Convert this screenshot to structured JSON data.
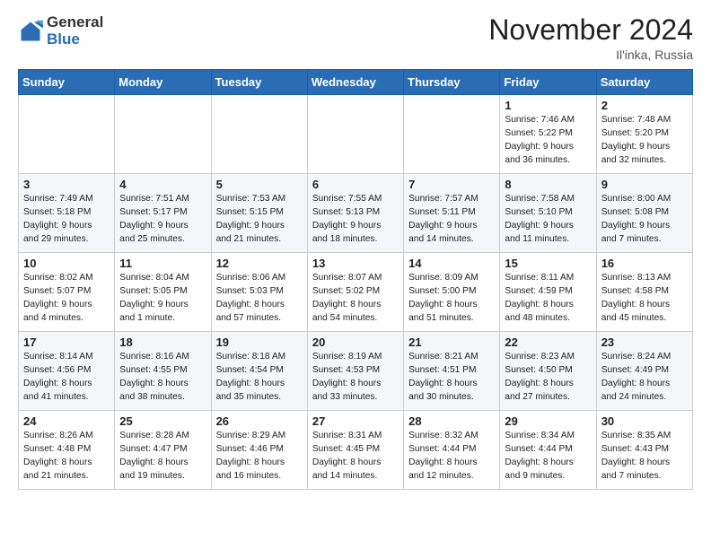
{
  "logo": {
    "general": "General",
    "blue": "Blue"
  },
  "header": {
    "month": "November 2024",
    "location": "Il'inka, Russia"
  },
  "weekdays": [
    "Sunday",
    "Monday",
    "Tuesday",
    "Wednesday",
    "Thursday",
    "Friday",
    "Saturday"
  ],
  "weeks": [
    [
      {
        "day": "",
        "info": ""
      },
      {
        "day": "",
        "info": ""
      },
      {
        "day": "",
        "info": ""
      },
      {
        "day": "",
        "info": ""
      },
      {
        "day": "",
        "info": ""
      },
      {
        "day": "1",
        "info": "Sunrise: 7:46 AM\nSunset: 5:22 PM\nDaylight: 9 hours\nand 36 minutes."
      },
      {
        "day": "2",
        "info": "Sunrise: 7:48 AM\nSunset: 5:20 PM\nDaylight: 9 hours\nand 32 minutes."
      }
    ],
    [
      {
        "day": "3",
        "info": "Sunrise: 7:49 AM\nSunset: 5:18 PM\nDaylight: 9 hours\nand 29 minutes."
      },
      {
        "day": "4",
        "info": "Sunrise: 7:51 AM\nSunset: 5:17 PM\nDaylight: 9 hours\nand 25 minutes."
      },
      {
        "day": "5",
        "info": "Sunrise: 7:53 AM\nSunset: 5:15 PM\nDaylight: 9 hours\nand 21 minutes."
      },
      {
        "day": "6",
        "info": "Sunrise: 7:55 AM\nSunset: 5:13 PM\nDaylight: 9 hours\nand 18 minutes."
      },
      {
        "day": "7",
        "info": "Sunrise: 7:57 AM\nSunset: 5:11 PM\nDaylight: 9 hours\nand 14 minutes."
      },
      {
        "day": "8",
        "info": "Sunrise: 7:58 AM\nSunset: 5:10 PM\nDaylight: 9 hours\nand 11 minutes."
      },
      {
        "day": "9",
        "info": "Sunrise: 8:00 AM\nSunset: 5:08 PM\nDaylight: 9 hours\nand 7 minutes."
      }
    ],
    [
      {
        "day": "10",
        "info": "Sunrise: 8:02 AM\nSunset: 5:07 PM\nDaylight: 9 hours\nand 4 minutes."
      },
      {
        "day": "11",
        "info": "Sunrise: 8:04 AM\nSunset: 5:05 PM\nDaylight: 9 hours\nand 1 minute."
      },
      {
        "day": "12",
        "info": "Sunrise: 8:06 AM\nSunset: 5:03 PM\nDaylight: 8 hours\nand 57 minutes."
      },
      {
        "day": "13",
        "info": "Sunrise: 8:07 AM\nSunset: 5:02 PM\nDaylight: 8 hours\nand 54 minutes."
      },
      {
        "day": "14",
        "info": "Sunrise: 8:09 AM\nSunset: 5:00 PM\nDaylight: 8 hours\nand 51 minutes."
      },
      {
        "day": "15",
        "info": "Sunrise: 8:11 AM\nSunset: 4:59 PM\nDaylight: 8 hours\nand 48 minutes."
      },
      {
        "day": "16",
        "info": "Sunrise: 8:13 AM\nSunset: 4:58 PM\nDaylight: 8 hours\nand 45 minutes."
      }
    ],
    [
      {
        "day": "17",
        "info": "Sunrise: 8:14 AM\nSunset: 4:56 PM\nDaylight: 8 hours\nand 41 minutes."
      },
      {
        "day": "18",
        "info": "Sunrise: 8:16 AM\nSunset: 4:55 PM\nDaylight: 8 hours\nand 38 minutes."
      },
      {
        "day": "19",
        "info": "Sunrise: 8:18 AM\nSunset: 4:54 PM\nDaylight: 8 hours\nand 35 minutes."
      },
      {
        "day": "20",
        "info": "Sunrise: 8:19 AM\nSunset: 4:53 PM\nDaylight: 8 hours\nand 33 minutes."
      },
      {
        "day": "21",
        "info": "Sunrise: 8:21 AM\nSunset: 4:51 PM\nDaylight: 8 hours\nand 30 minutes."
      },
      {
        "day": "22",
        "info": "Sunrise: 8:23 AM\nSunset: 4:50 PM\nDaylight: 8 hours\nand 27 minutes."
      },
      {
        "day": "23",
        "info": "Sunrise: 8:24 AM\nSunset: 4:49 PM\nDaylight: 8 hours\nand 24 minutes."
      }
    ],
    [
      {
        "day": "24",
        "info": "Sunrise: 8:26 AM\nSunset: 4:48 PM\nDaylight: 8 hours\nand 21 minutes."
      },
      {
        "day": "25",
        "info": "Sunrise: 8:28 AM\nSunset: 4:47 PM\nDaylight: 8 hours\nand 19 minutes."
      },
      {
        "day": "26",
        "info": "Sunrise: 8:29 AM\nSunset: 4:46 PM\nDaylight: 8 hours\nand 16 minutes."
      },
      {
        "day": "27",
        "info": "Sunrise: 8:31 AM\nSunset: 4:45 PM\nDaylight: 8 hours\nand 14 minutes."
      },
      {
        "day": "28",
        "info": "Sunrise: 8:32 AM\nSunset: 4:44 PM\nDaylight: 8 hours\nand 12 minutes."
      },
      {
        "day": "29",
        "info": "Sunrise: 8:34 AM\nSunset: 4:44 PM\nDaylight: 8 hours\nand 9 minutes."
      },
      {
        "day": "30",
        "info": "Sunrise: 8:35 AM\nSunset: 4:43 PM\nDaylight: 8 hours\nand 7 minutes."
      }
    ]
  ]
}
